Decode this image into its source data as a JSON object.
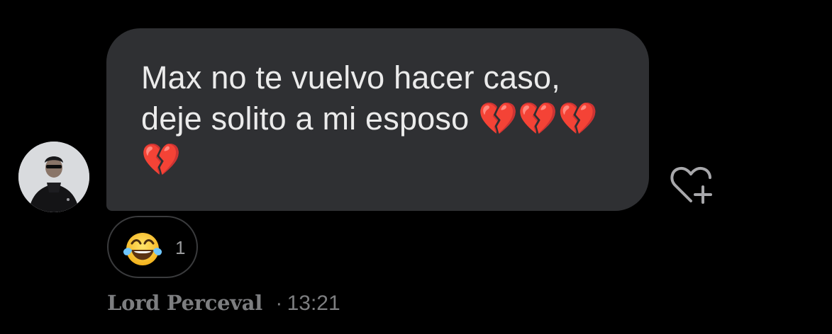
{
  "message": {
    "text": "Max no te vuelvo hacer caso, deje solito a mi esposo 💔💔💔💔",
    "colors": {
      "bubble": "#2f3033",
      "text": "#ebebeb",
      "background": "#000000"
    }
  },
  "reaction": {
    "emoji_icon": "face-with-tears-of-joy-icon",
    "count": "1"
  },
  "sender": {
    "name": "Lord Perceval",
    "separator": "·",
    "time": "13:21"
  },
  "icons": {
    "react": "heart-plus-icon",
    "avatar": "user-avatar"
  }
}
